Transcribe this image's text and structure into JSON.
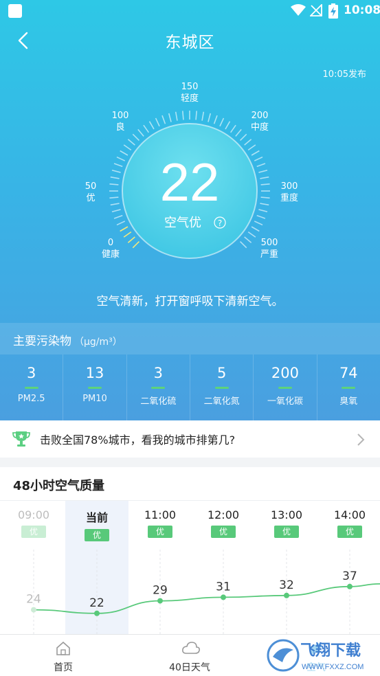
{
  "status_bar": {
    "time": "10:08"
  },
  "header": {
    "title": "东城区",
    "publish_time": "10:05发布"
  },
  "gauge": {
    "value": "22",
    "label": "空气优",
    "scale": [
      {
        "num": "0",
        "text": "健康"
      },
      {
        "num": "50",
        "text": "优"
      },
      {
        "num": "100",
        "text": "良"
      },
      {
        "num": "150",
        "text": "轻度"
      },
      {
        "num": "200",
        "text": "中度"
      },
      {
        "num": "300",
        "text": "重度"
      },
      {
        "num": "500",
        "text": "严重"
      }
    ],
    "colors": {
      "ring": "#3fc4e4",
      "good": "#f5e87a"
    }
  },
  "tip": "空气清新，打开窗呼吸下清新空气。",
  "pollutants": {
    "title": "主要污染物",
    "unit": "（μg/m³）",
    "items": [
      {
        "value": "3",
        "name": "PM2.5"
      },
      {
        "value": "13",
        "name": "PM10"
      },
      {
        "value": "3",
        "name": "二氧化硫"
      },
      {
        "value": "5",
        "name": "二氧化氮"
      },
      {
        "value": "200",
        "name": "一氧化碳"
      },
      {
        "value": "74",
        "name": "臭氧"
      }
    ]
  },
  "ranking": {
    "text": "击败全国78%城市，看我的城市排第几?"
  },
  "hourly": {
    "title": "48小时空气质量",
    "accent": "#58c97a",
    "hours": [
      {
        "time": "09:00",
        "level": "优",
        "aqi": 24,
        "aqi_text": "24"
      },
      {
        "time": "当前",
        "level": "优",
        "aqi": 22,
        "aqi_text": "22"
      },
      {
        "time": "11:00",
        "level": "优",
        "aqi": 29,
        "aqi_text": "29"
      },
      {
        "time": "12:00",
        "level": "优",
        "aqi": 31,
        "aqi_text": "31"
      },
      {
        "time": "13:00",
        "level": "优",
        "aqi": 32,
        "aqi_text": "32"
      },
      {
        "time": "14:00",
        "level": "优",
        "aqi": 37,
        "aqi_text": "37"
      }
    ]
  },
  "tabs": [
    {
      "label": "首页",
      "icon": "home-icon"
    },
    {
      "label": "40日天气",
      "icon": "cloud-icon"
    },
    {
      "label": "空气",
      "icon": "leaf-icon"
    }
  ],
  "watermark": {
    "text": "飞翔下载",
    "url": "WWW.FXXZ.COM"
  }
}
